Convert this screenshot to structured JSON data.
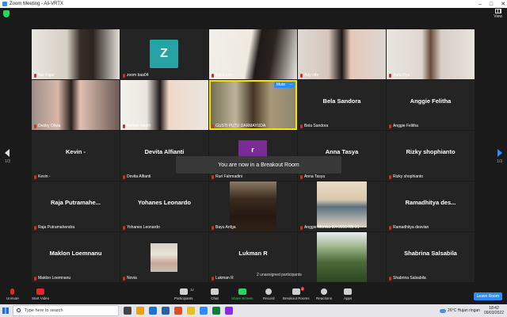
{
  "window": {
    "title": "Zoom Meeting - Ali-VRTX",
    "controls": [
      "–",
      "□",
      "✕"
    ]
  },
  "topbar": {
    "view_label": "View"
  },
  "participants": [
    {
      "name": "Nur Fajar",
      "big": "",
      "kind": "video",
      "style": "vid1"
    },
    {
      "name": "zoom baa04",
      "big": "",
      "kind": "avatar",
      "avatar": "Z"
    },
    {
      "name": "Erica Lim",
      "big": "",
      "kind": "video",
      "style": "vid3"
    },
    {
      "name": "Ady otto",
      "big": "",
      "kind": "video",
      "style": "vid4"
    },
    {
      "name": "Aura Dya",
      "big": "",
      "kind": "video",
      "style": "vid5"
    },
    {
      "name": "Debby Olivia",
      "big": "",
      "kind": "video",
      "style": "vid6"
    },
    {
      "name": "Hafilah Nadifi",
      "big": "",
      "kind": "video",
      "style": "vid7"
    },
    {
      "name": "GUSTI PUTU DARMAYUDA",
      "big": "",
      "kind": "video",
      "style": "vid8",
      "active": true
    },
    {
      "name": "Bela Sandora",
      "big": "Bela Sandora",
      "kind": "name"
    },
    {
      "name": "Anggie Felitha",
      "big": "Anggie Felitha",
      "kind": "name"
    },
    {
      "name": "Kevin -",
      "big": "Kevin -",
      "kind": "name"
    },
    {
      "name": "Devita Alfianti",
      "big": "Devita Alfianti",
      "kind": "name"
    },
    {
      "name": "Ruri Fahmadini",
      "big": "",
      "kind": "ravatar",
      "avatar": "r"
    },
    {
      "name": "Anna Tasya",
      "big": "Anna Tasya",
      "kind": "name"
    },
    {
      "name": "Rizky shophianto",
      "big": "Rizky shophianto",
      "kind": "name"
    },
    {
      "name": "Raja Putramahendra",
      "big": "Raja  Putramahe...",
      "kind": "name"
    },
    {
      "name": "Yohanes Leonardo",
      "big": "Yohanes Leonardo",
      "kind": "name"
    },
    {
      "name": "Bayu Anfga",
      "big": "",
      "kind": "photo",
      "style": "vid-kayu"
    },
    {
      "name": "Anggie Munika-EA-2001785 01",
      "big": "",
      "kind": "photo",
      "style": "vid-anggie"
    },
    {
      "name": "Ramadhitya desvian",
      "big": "Ramadhitya  des...",
      "kind": "name"
    },
    {
      "name": "Maklon Loemnanu",
      "big": "Maklon Loemnanu",
      "kind": "name"
    },
    {
      "name": "Novia",
      "big": "",
      "kind": "photo",
      "style": "vid-novia"
    },
    {
      "name": "Lukman R",
      "big": "Lukman R",
      "kind": "name"
    },
    {
      "name": "",
      "big": "",
      "kind": "photo",
      "style": "vid-bottom"
    },
    {
      "name": "Shabrina Salsabila",
      "big": "Shabrina Salsabila",
      "kind": "name"
    }
  ],
  "active_tile": {
    "mute_label": "Mute",
    "more_label": "···"
  },
  "toast": "You are now in a Breakout Room",
  "page_nav": {
    "left": "1/3",
    "right": "1/3"
  },
  "unassigned": "2 unassigned participants",
  "toolbar": {
    "unmute": "Unmute",
    "start_video": "Start Video",
    "participants": "Participants",
    "participants_count": "32",
    "chat": "Chat",
    "share_screen": "Share Screen",
    "record": "Record",
    "breakout_rooms": "Breakout Rooms",
    "breakout_badge": "2",
    "reactions": "Reactions",
    "apps": "Apps",
    "leave": "Leave Room"
  },
  "taskbar": {
    "search_placeholder": "Type here to search",
    "weather": "26°C  Hujan ringan",
    "time": "18:42",
    "date": "09/03/2022",
    "app_colors": [
      "#444444",
      "#e8a317",
      "#1a73d1",
      "#2c5f9e",
      "#d94f2b",
      "#e8c023",
      "#2d8cff",
      "#0f7b3f",
      "#8a2be2"
    ]
  },
  "colors": {
    "zoom_blue": "#2d8cff",
    "active_speaker": "#f5e600",
    "mute_red": "#e02828",
    "share_green": "#23d959"
  }
}
